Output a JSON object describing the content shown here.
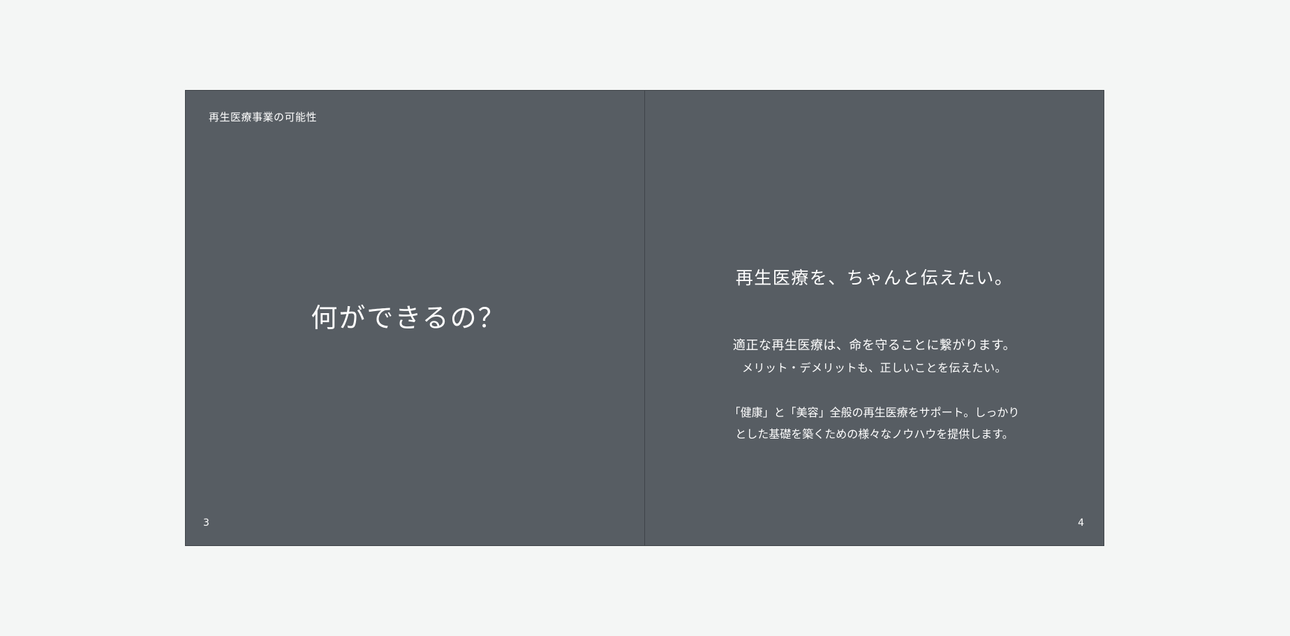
{
  "left_page": {
    "running_head": "再生医療事業の可能性",
    "title": "何ができるの？",
    "page_number": "3"
  },
  "right_page": {
    "heading": "再生医療を、ちゃんと伝えたい。",
    "lead_lines": [
      "適正な再生医療は、命を守ることに繋がります。",
      "メリット・デメリットも、正しいことを伝えたい。"
    ],
    "body_lines": [
      "「健康」と「美容」全般の再生医療をサポート。しっかり",
      "とした基礎を築くための様々なノウハウを提供します。"
    ],
    "page_number": "4"
  }
}
